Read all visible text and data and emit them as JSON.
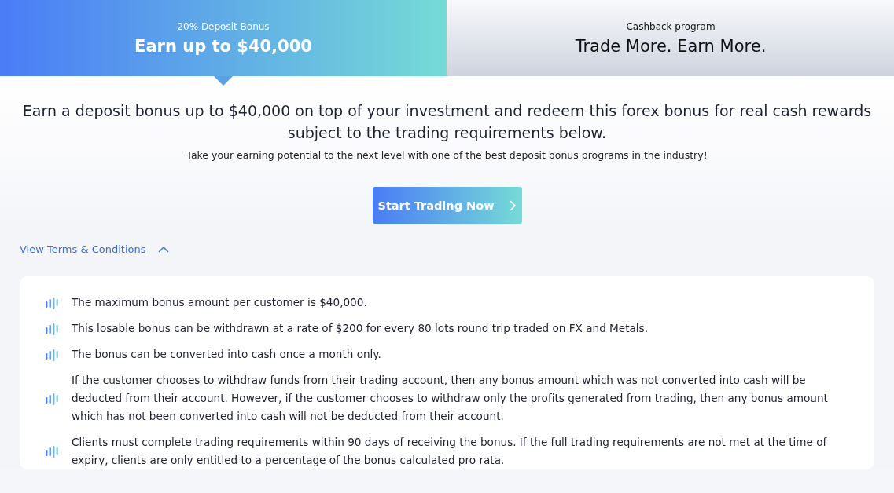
{
  "tabs": [
    {
      "label": "20% Deposit Bonus",
      "title": "Earn up to $40,000",
      "selected": true
    },
    {
      "label": "Cashback program",
      "title": "Trade More. Earn More.",
      "selected": false
    }
  ],
  "heading": "Earn a deposit bonus up to $40,000 on top of your investment and redeem this forex bonus for real cash rewards subject to the trading requirements below.",
  "subheading": "Take your earning potential to the next level with one of the best deposit bonus programs in the industry!",
  "cta_button": "Start Trading Now",
  "terms_toggle": {
    "label": "View Terms & Conditions",
    "expanded": true
  },
  "terms": [
    "The maximum bonus amount per customer is $40,000.",
    "This losable bonus can be withdrawn at a rate of $200 for every 80 lots round trip traded on FX and Metals.",
    "The bonus can be converted into cash once a month only.",
    "If the customer chooses to withdraw funds from their trading account, then any bonus amount which was not converted into cash will be deducted from their account. However, if the customer chooses to withdraw only the profits generated from trading, then any bonus amount which has not been converted into cash will not be deducted from their account.",
    "Clients must complete trading requirements within 90 days of receiving the bonus. If the full trading requirements are not met at the time of expiry, clients are only entitled to a percentage of the bonus calculated pro rata."
  ]
}
